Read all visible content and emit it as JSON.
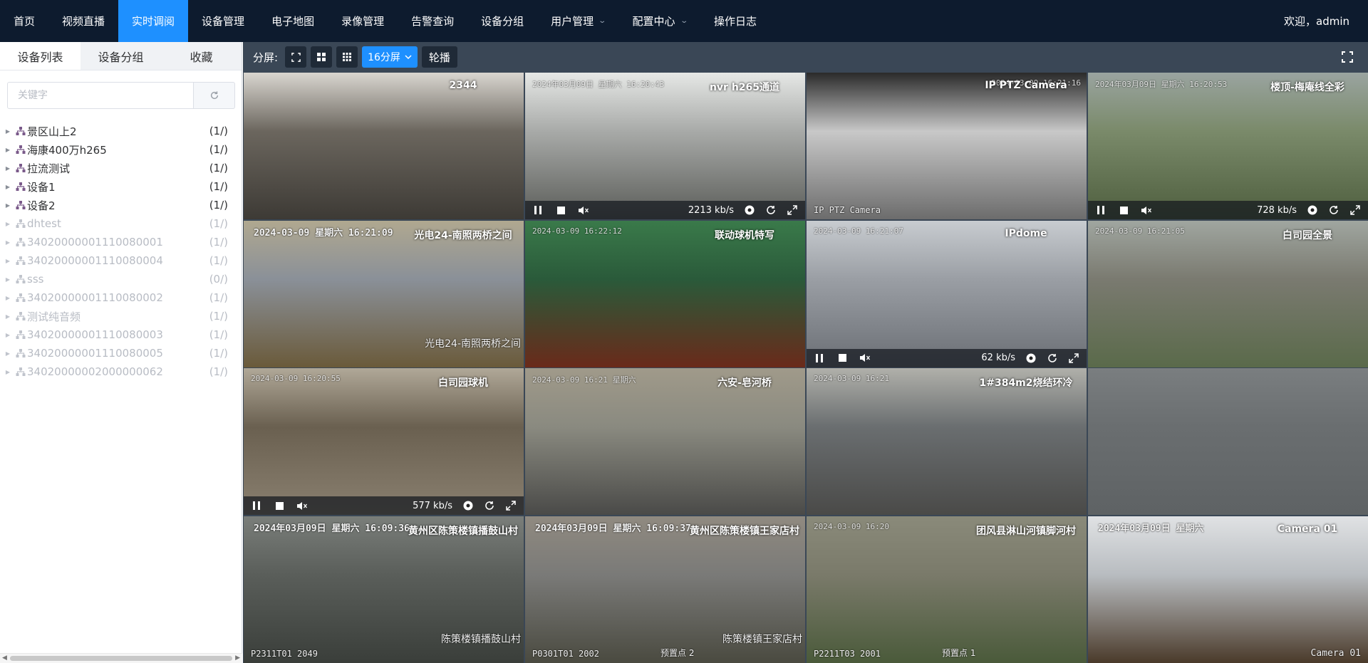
{
  "nav": {
    "items": [
      {
        "label": "首页"
      },
      {
        "label": "视频直播"
      },
      {
        "label": "实时调阅",
        "active": true
      },
      {
        "label": "设备管理"
      },
      {
        "label": "电子地图"
      },
      {
        "label": "录像管理"
      },
      {
        "label": "告警查询"
      },
      {
        "label": "设备分组"
      },
      {
        "label": "用户管理",
        "dropdown": true
      },
      {
        "label": "配置中心",
        "dropdown": true
      },
      {
        "label": "操作日志"
      }
    ],
    "welcome": "欢迎，admin",
    "active_color": "#1e90ff",
    "background": "#0d1b2e"
  },
  "sidebar": {
    "tabs": [
      "设备列表",
      "设备分组",
      "收藏"
    ],
    "active_tab": "设备列表",
    "search": {
      "placeholder": "关键字",
      "value": ""
    },
    "tree": [
      {
        "label": "景区山上2",
        "count": "(1/)",
        "online": true
      },
      {
        "label": "海康400万h265",
        "count": "(1/)",
        "online": true
      },
      {
        "label": "拉流测试",
        "count": "(1/)",
        "online": true
      },
      {
        "label": "设备1",
        "count": "(1/)",
        "online": true
      },
      {
        "label": "设备2",
        "count": "(1/)",
        "online": true
      },
      {
        "label": "dhtest",
        "count": "(1/)",
        "online": false
      },
      {
        "label": "34020000001110080001",
        "count": "(1/)",
        "online": false
      },
      {
        "label": "34020000001110080004",
        "count": "(1/)",
        "online": false
      },
      {
        "label": "sss",
        "count": "(0/)",
        "online": false
      },
      {
        "label": "34020000001110080002",
        "count": "(1/)",
        "online": false
      },
      {
        "label": "测试纯音频",
        "count": "(1/)",
        "online": false
      },
      {
        "label": "34020000001110080003",
        "count": "(1/)",
        "online": false
      },
      {
        "label": "34020000001110080005",
        "count": "(1/)",
        "online": false
      },
      {
        "label": "34020000002000000062",
        "count": "(1/)",
        "online": false
      }
    ]
  },
  "toolbar": {
    "split_label": "分屏:",
    "split_select": "16分屏",
    "carousel_label": "轮播"
  },
  "cells": [
    {
      "title": "2344",
      "selected": true
    },
    {
      "title": "nvr h265通道",
      "osd": "2024年03月09日 星期六 16:20:43",
      "rate": "2213 kb/s"
    },
    {
      "title": "IP PTZ Camera",
      "osd_right": "2024-03-09 16:21:16",
      "osd_bottom": "IP PTZ Camera"
    },
    {
      "title": "楼顶-梅庵线全彩",
      "osd": "2024年03月09日 星期六 16:20:53",
      "rate": "728 kb/s"
    },
    {
      "title": "光电24-南照两桥之间",
      "osd_big": "2024-03-09  星期六  16:21:09",
      "caption": "光电24-南照两桥之间"
    },
    {
      "title": "联动球机特写",
      "osd": "2024-03-09 16:22:12"
    },
    {
      "title": "IPdome",
      "osd": "2024-03-09 16:21:07",
      "rate": "62 kb/s"
    },
    {
      "title": "白司园全景",
      "osd": "2024-03-09 16:21:05"
    },
    {
      "title": "白司园球机",
      "osd": "2024-03-09 16:20:55",
      "rate": "577 kb/s"
    },
    {
      "title": "六安-皂河桥",
      "osd": "2024-03-09 16:21 星期六"
    },
    {
      "title": "1#384m2烧结环冷",
      "osd": "2024-03-09 16:21"
    },
    {
      "title": ""
    },
    {
      "title": "黄州区陈策楼镇播鼓山村",
      "osd_big": "2024年03月09日  星期六  16:09:36",
      "caption": "陈策楼镇播鼓山村",
      "osd_bottom": "P2311T01  2049"
    },
    {
      "title": "黄州区陈策楼镇王家店村",
      "osd_big": "2024年03月09日  星期六  16:09:37",
      "caption": "陈策楼镇王家店村",
      "osd_bottom": "P0301T01  2002",
      "caption2": "预置点 2"
    },
    {
      "title": "团风县淋山河镇脚河村",
      "osd": "2024-03-09 16:20",
      "osd_bottom": "P2211T03  2001",
      "caption2": "预置点 1"
    },
    {
      "title": "Camera 01",
      "osd_big": "2024年03月09日 星期六",
      "osd_bottom_r": "Camera 01"
    }
  ]
}
